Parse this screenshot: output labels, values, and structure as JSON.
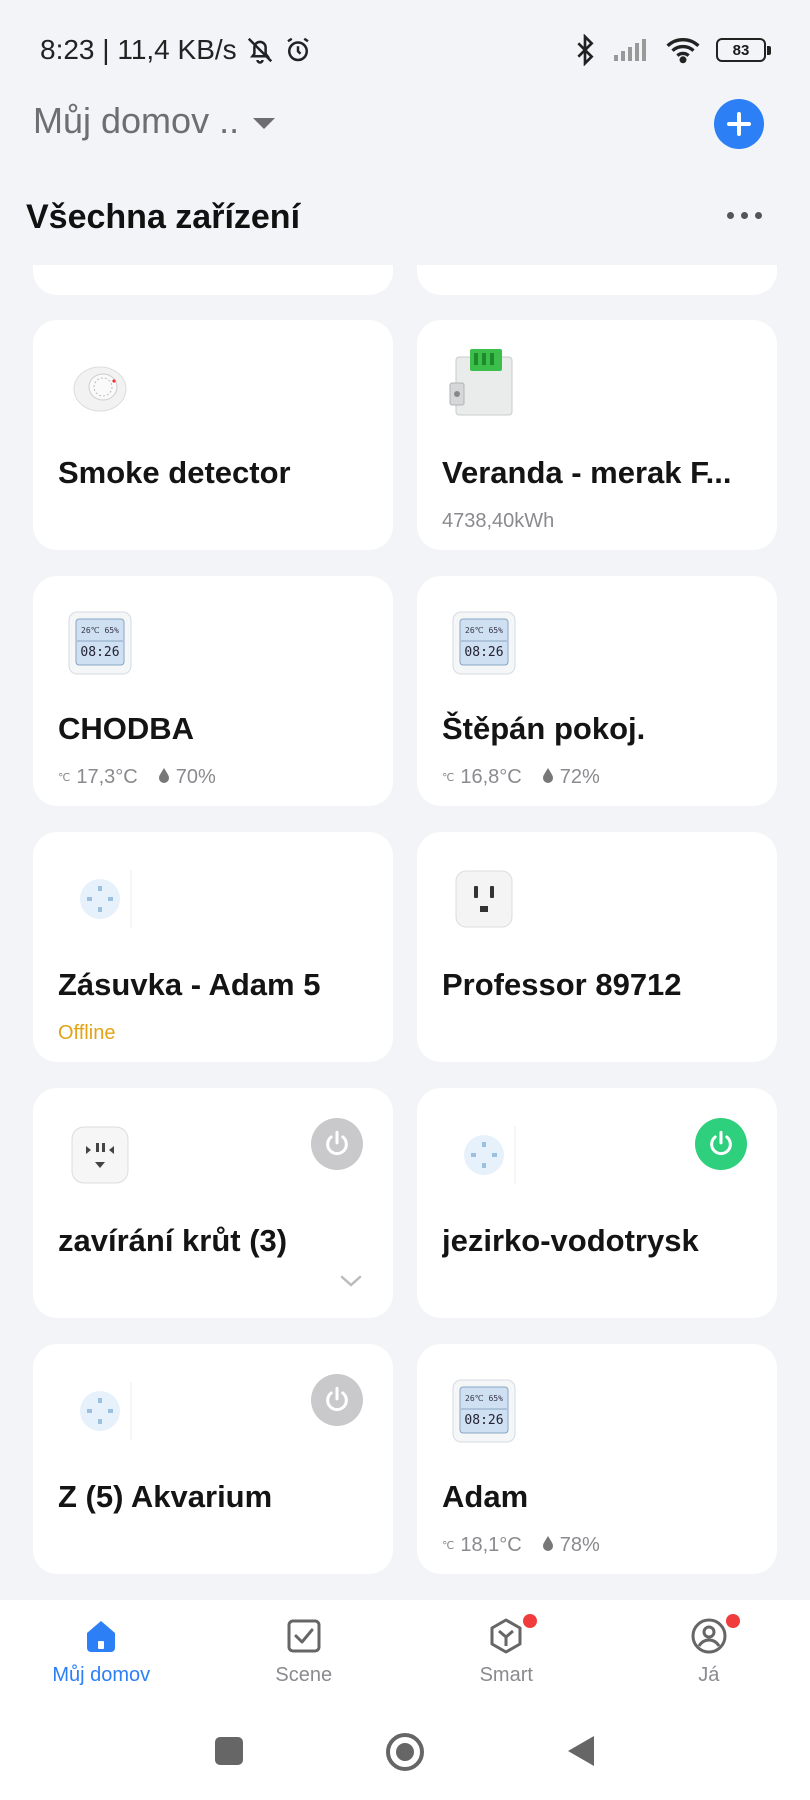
{
  "status_bar": {
    "time_speed": "8:23 | 11,4 KB/s",
    "battery": "83"
  },
  "header": {
    "home_name": "Můj domov ..",
    "section_title": "Všechna zařízení"
  },
  "devices": [
    {
      "name": "Smoke detector",
      "sub": "",
      "icon": "smoke-detector-icon"
    },
    {
      "name": "Veranda - merak F...",
      "sub": "4738,40kWh",
      "icon": "energy-meter-icon"
    },
    {
      "name": "CHODBA",
      "temp": "17,3°C",
      "humidity": "70%",
      "icon": "thermometer-display-icon"
    },
    {
      "name": "Štěpán pokoj.",
      "temp": "16,8°C",
      "humidity": "72%",
      "icon": "thermometer-display-icon"
    },
    {
      "name": "Zásuvka - Adam 5",
      "status": "Offline",
      "icon": "smart-plug-icon"
    },
    {
      "name": "Professor 89712",
      "icon": "wall-outlet-icon"
    },
    {
      "name": "zavírání krůt (3)",
      "icon": "power-strip-icon",
      "power": "off"
    },
    {
      "name": "jezirko-vodotrysk",
      "icon": "smart-plug-icon",
      "power": "on"
    },
    {
      "name": "Z (5) Akvarium",
      "icon": "smart-plug-icon",
      "power": "off"
    },
    {
      "name": "Adam",
      "temp": "18,1°C",
      "humidity": "78%",
      "icon": "thermometer-display-icon"
    }
  ],
  "bottom_nav": [
    {
      "label": "Můj domov",
      "icon": "home-icon",
      "active": true
    },
    {
      "label": "Scene",
      "icon": "checkbox-icon"
    },
    {
      "label": "Smart",
      "icon": "smart-cube-icon",
      "badge": true
    },
    {
      "label": "Já",
      "icon": "profile-icon",
      "badge": true
    }
  ],
  "colors": {
    "accent": "#2d7ff6",
    "power_on": "#2ed07d",
    "offline": "#e2a416"
  }
}
